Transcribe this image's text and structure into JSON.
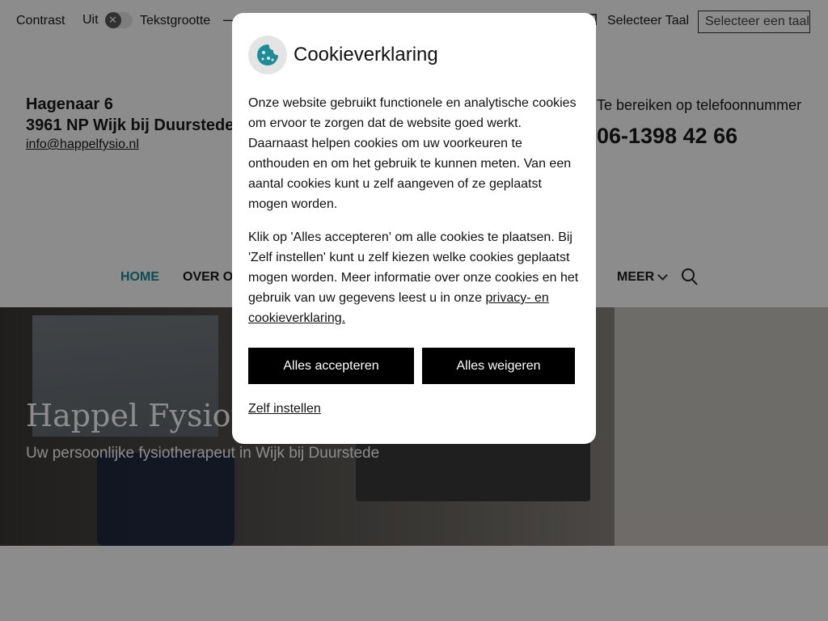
{
  "topbar": {
    "contrast_label": "Contrast",
    "contrast_state": "Uit",
    "contrast_toggle_glyph": "✕",
    "textsize_label": "Tekstgrootte",
    "textsize_minus": "—",
    "language_label": "Selecteer Taal",
    "language_select_value": "Selecteer een taal",
    "language_select_chevron": "▾"
  },
  "address": {
    "street": "Hagenaar 6",
    "city": "3961 NP Wijk bij Duurstede",
    "email": "info@happelfysio.nl"
  },
  "phone": {
    "label": "Te bereiken op telefoonnummer",
    "number": "06-1398 42 66"
  },
  "nav": {
    "items": [
      {
        "label": "HOME",
        "active": true
      },
      {
        "label": "OVER ONS",
        "active": false
      },
      {
        "label": "MEER",
        "active": false
      }
    ],
    "search_icon": "search-icon",
    "active_color": "#1c8d96"
  },
  "hero": {
    "title": "Happel Fysiotherapie",
    "subtitle": "Uw persoonlijke fysiotherapeut in Wijk bij Duurstede"
  },
  "cookie_modal": {
    "icon": "cookie-icon",
    "icon_color": "#1c8d96",
    "title": "Cookieverklaring",
    "paragraph1": "Onze website gebruikt functionele en analytische cookies om ervoor te zorgen dat de website goed werkt. Daarnaast helpen cookies om uw voorkeuren te onthouden en om het gebruik te kunnen meten. Van een aantal cookies kunt u zelf aangeven of ze geplaatst mogen worden.",
    "paragraph2": "Klik op 'Alles accepteren' om alle cookies te plaatsen. Bij 'Zelf instellen' kunt u zelf kiezen welke cookies geplaatst mogen worden. Meer informatie over onze cookies en het gebruik van uw gegevens leest u in onze",
    "policy_link": "privacy- en cookieverklaring.",
    "accept_label": "Alles accepteren",
    "reject_label": "Alles weigeren",
    "custom_label": "Zelf instellen"
  }
}
